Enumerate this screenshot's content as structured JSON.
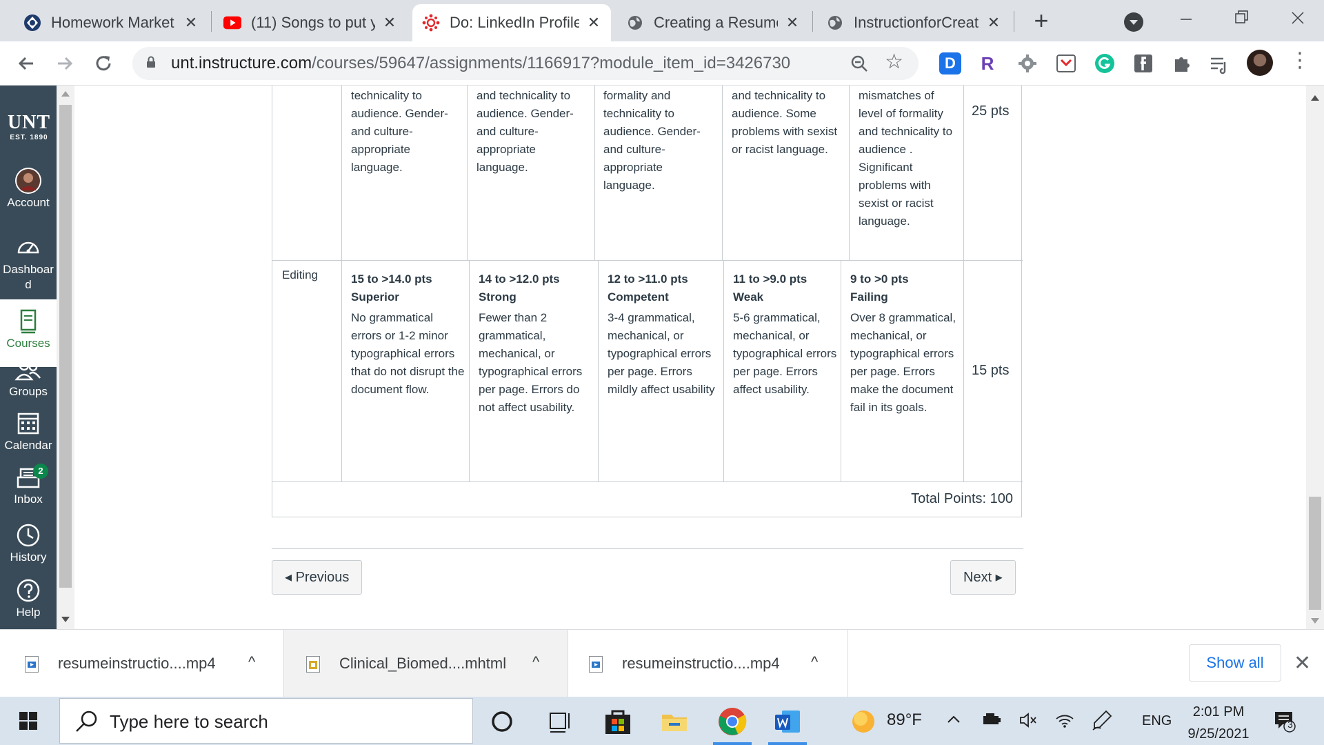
{
  "browser": {
    "tabs": [
      {
        "title": "Homework Market",
        "icon": "homework-market-icon",
        "active": false
      },
      {
        "title": "(11) Songs to put y",
        "icon": "youtube-icon",
        "active": false
      },
      {
        "title": "Do: LinkedIn Profile",
        "icon": "canvas-icon",
        "active": true
      },
      {
        "title": "Creating a Resume",
        "icon": "globe-icon",
        "active": false
      },
      {
        "title": "InstructionforCreati",
        "icon": "globe-icon",
        "active": false
      }
    ],
    "close_glyph": "✕",
    "new_tab_glyph": "+",
    "url_host": "unt.instructure.com",
    "url_path": "/courses/59647/assignments/1166917?module_item_id=3426730",
    "extensions": [
      {
        "name": "D",
        "color": "#1a73e8"
      },
      {
        "name": "R",
        "color": "#6a3fb5"
      }
    ]
  },
  "sidenav": {
    "logo_big": "UNT",
    "logo_small": "EST. 1890",
    "items": [
      {
        "label": "Account",
        "icon": "account-avatar-icon",
        "active": false
      },
      {
        "label": "Dashboar d",
        "icon": "dashboard-icon",
        "active": false
      },
      {
        "label": "Courses",
        "icon": "courses-icon",
        "active": true
      },
      {
        "label": "Groups",
        "icon": "groups-icon",
        "active": false
      },
      {
        "label": "Calendar",
        "icon": "calendar-icon",
        "active": false
      },
      {
        "label": "Inbox",
        "icon": "inbox-icon",
        "active": false,
        "badge": "2"
      },
      {
        "label": "History",
        "icon": "history-icon",
        "active": false
      },
      {
        "label": "Help",
        "icon": "help-icon",
        "active": false
      }
    ]
  },
  "rubric": {
    "row1": {
      "cells": [
        "technicality to audience. Gender- and culture- appropriate language.",
        "and technicality to audience. Gender- and culture- appropriate language.",
        "formality and technicality to audience. Gender- and culture- appropriate language.",
        "and technicality to audience. Some problems with sexist or racist language.",
        "mismatches of level of formality and technicality to audience . Significant problems with sexist or racist language."
      ],
      "points": "25 pts"
    },
    "row2": {
      "criterion": "Editing",
      "cells": [
        {
          "pts": "15 to >14.0 pts",
          "rating": "Superior",
          "desc": "No grammatical errors or 1-2 minor typographical errors that do not disrupt the document flow."
        },
        {
          "pts": "14 to >12.0 pts",
          "rating": "Strong",
          "desc": "Fewer than 2 grammatical, mechanical, or typographical errors per page. Errors do not affect usability."
        },
        {
          "pts": "12 to >11.0 pts",
          "rating": "Competent",
          "desc": "3-4 grammatical, mechanical, or typographical errors per page. Errors mildly affect usability"
        },
        {
          "pts": "11 to >9.0 pts",
          "rating": "Weak",
          "desc": "5-6 grammatical, mechanical, or typographical errors per page. Errors affect usability."
        },
        {
          "pts": "9 to >0 pts",
          "rating": "Failing",
          "desc": "Over 8 grammatical, mechanical, or typographical errors per page. Errors make the document fail in its goals."
        }
      ],
      "points": "15 pts"
    },
    "total": "Total Points: 100"
  },
  "pager": {
    "previous": "◂ Previous",
    "next": "Next ▸"
  },
  "downloads": {
    "items": [
      {
        "name": "resumeinstructio....mp4",
        "icon": "video-file-icon"
      },
      {
        "name": "Clinical_Biomed....mhtml",
        "icon": "mhtml-file-icon"
      },
      {
        "name": "resumeinstructio....mp4",
        "icon": "video-file-icon"
      }
    ],
    "chevron": "^",
    "show_all": "Show all",
    "close": "✕"
  },
  "taskbar": {
    "search_placeholder": "Type here to search",
    "weather": "89°F",
    "lang": "ENG",
    "time": "2:01 PM",
    "date": "9/25/2021",
    "notifications": "3"
  }
}
